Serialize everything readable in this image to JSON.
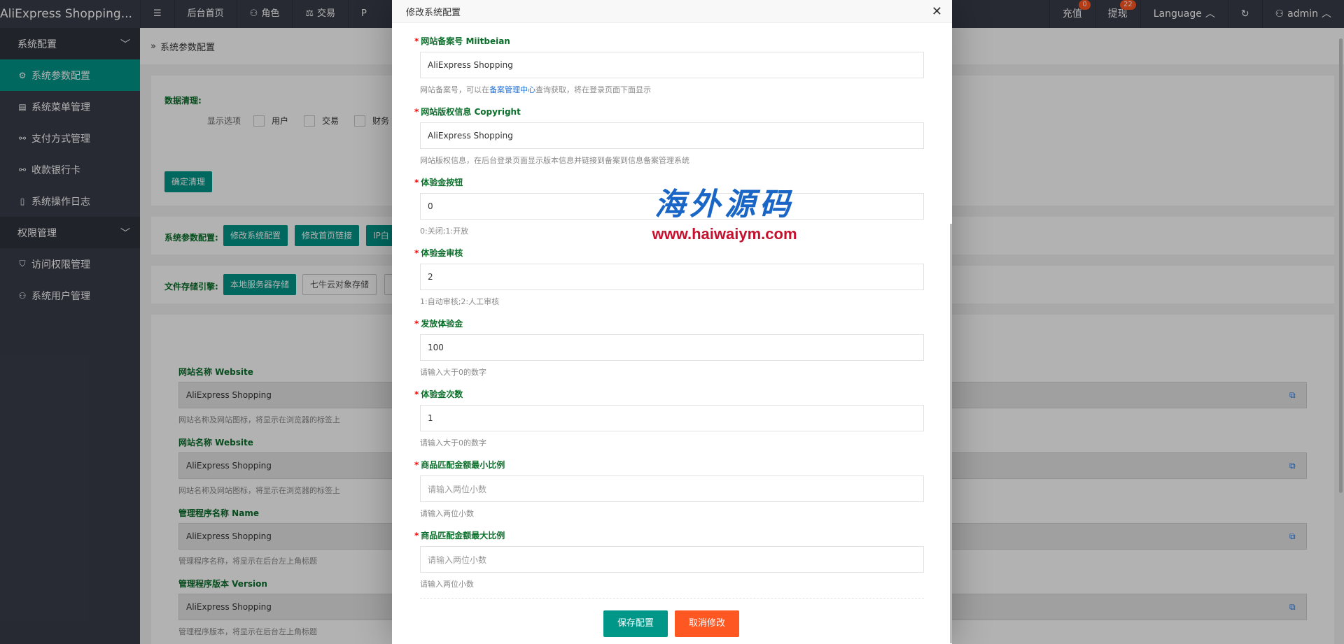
{
  "topbar": {
    "brand": "AliExpress Shopping...",
    "menu_toggle": "☰",
    "nav": [
      "后台首页",
      "角色",
      "交易",
      "P"
    ],
    "recharge": "充值",
    "recharge_badge": "0",
    "withdraw": "提现",
    "withdraw_badge": "22",
    "language": "Language",
    "admin": "admin"
  },
  "sidebar": {
    "groups": [
      {
        "label": "系统配置"
      },
      {
        "label": "权限管理"
      }
    ],
    "items": [
      {
        "label": "系统参数配置"
      },
      {
        "label": "系统菜单管理"
      },
      {
        "label": "支付方式管理"
      },
      {
        "label": "收款银行卡"
      },
      {
        "label": "系统操作日志"
      },
      {
        "label": "访问权限管理"
      },
      {
        "label": "系统用户管理"
      }
    ]
  },
  "breadcrumb": "系统参数配置",
  "cleanup": {
    "title": "数据清理:",
    "display_label": "显示选项",
    "options": [
      "用户",
      "交易",
      "财务"
    ],
    "confirm": "确定清理"
  },
  "sys_params": {
    "label": "系统参数配置:",
    "buttons": [
      "修改系统配置",
      "修改首页链接",
      "IP白"
    ]
  },
  "storage": {
    "label": "文件存储引擎:",
    "buttons": [
      "本地服务器存储",
      "七牛云对象存储"
    ]
  },
  "bg_fields": [
    {
      "label": "网站名称 Website",
      "value": "AliExpress Shopping",
      "help": "网站名称及网站图标，将显示在浏览器的标签上"
    },
    {
      "label": "网站名称 Website",
      "value": "AliExpress Shopping",
      "help": "网站名称及网站图标，将显示在浏览器的标签上"
    },
    {
      "label": "管理程序名称 Name",
      "value": "AliExpress Shopping",
      "help": "管理程序名称，将显示在后台左上角标题"
    },
    {
      "label": "管理程序版本 Version",
      "value": "AliExpress Shopping",
      "help": "管理程序版本，将显示在后台左上角标题"
    }
  ],
  "modal": {
    "title": "修改系统配置",
    "close": "✕",
    "fields": [
      {
        "label": "网站备案号 Miitbeian",
        "value": "AliExpress Shopping",
        "placeholder": "",
        "help_pre": "网站备案号，可以在",
        "help_link": "备案管理中心",
        "help_post": "查询获取，将在登录页面下面显示"
      },
      {
        "label": "网站版权信息 Copyright",
        "value": "AliExpress Shopping",
        "placeholder": "",
        "help_pre": "网站版权信息，在后台登录页面显示版本信息并链接到备案到信息备案管理系统",
        "help_link": "",
        "help_post": ""
      },
      {
        "label": "体验金按钮",
        "value": "0",
        "placeholder": "",
        "help_pre": "0:关闭;1:开放",
        "help_link": "",
        "help_post": ""
      },
      {
        "label": "体验金审核",
        "value": "2",
        "placeholder": "",
        "help_pre": "1:自动审核;2:人工审核",
        "help_link": "",
        "help_post": ""
      },
      {
        "label": "发放体验金",
        "value": "100",
        "placeholder": "",
        "help_pre": "请输入大于0的数字",
        "help_link": "",
        "help_post": ""
      },
      {
        "label": "体验金次数",
        "value": "1",
        "placeholder": "",
        "help_pre": "请输入大于0的数字",
        "help_link": "",
        "help_post": ""
      },
      {
        "label": "商品匹配金额最小比例",
        "value": "",
        "placeholder": "请输入两位小数",
        "help_pre": "请输入两位小数",
        "help_link": "",
        "help_post": ""
      },
      {
        "label": "商品匹配金额最大比例",
        "value": "",
        "placeholder": "请输入两位小数",
        "help_pre": "请输入两位小数",
        "help_link": "",
        "help_post": ""
      }
    ],
    "save": "保存配置",
    "cancel": "取消修改"
  },
  "watermark": {
    "cn": "海外源码",
    "url": "www.haiwaiym.com"
  },
  "colors": {
    "primary": "#009688",
    "danger": "#ff5722",
    "dark": "#393d49",
    "label_green": "#0a6e2a",
    "link": "#1e6fd9"
  }
}
